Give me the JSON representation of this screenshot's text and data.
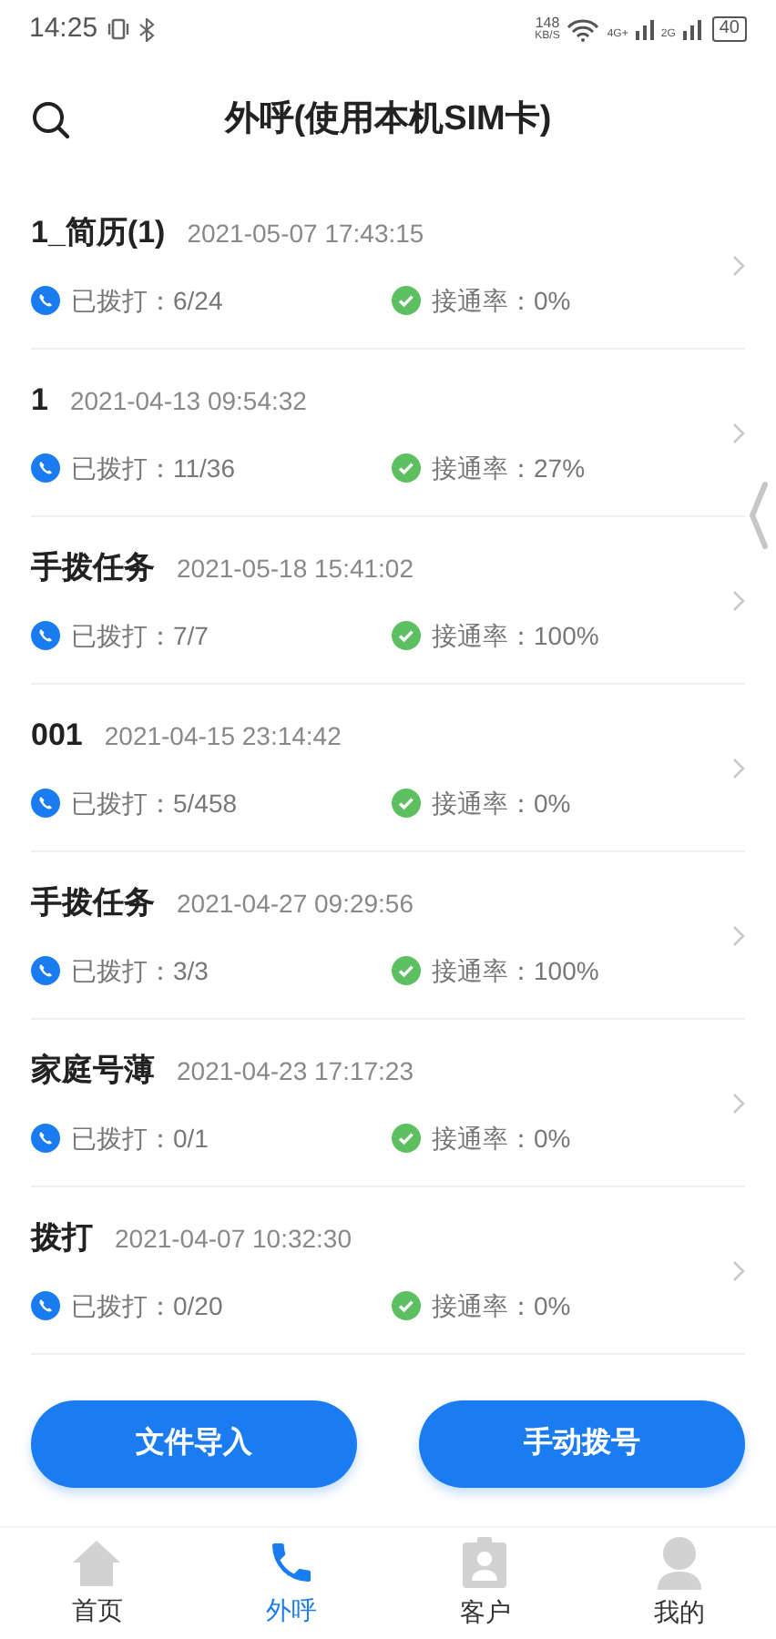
{
  "status_bar": {
    "time": "14:25",
    "speed": "148",
    "speed_unit": "KB/S",
    "network_1": "4G+",
    "network_2": "2G",
    "battery": "40"
  },
  "header": {
    "title": "外呼(使用本机SIM卡)"
  },
  "tasks": [
    {
      "name": "1_简历(1)",
      "time": "2021-05-07 17:43:15",
      "dialed": "已拨打：6/24",
      "rate": "接通率：0%"
    },
    {
      "name": "1",
      "time": "2021-04-13 09:54:32",
      "dialed": "已拨打：11/36",
      "rate": "接通率：27%"
    },
    {
      "name": "手拨任务",
      "time": "2021-05-18 15:41:02",
      "dialed": "已拨打：7/7",
      "rate": "接通率：100%"
    },
    {
      "name": "001",
      "time": "2021-04-15 23:14:42",
      "dialed": "已拨打：5/458",
      "rate": "接通率：0%"
    },
    {
      "name": "手拨任务",
      "time": "2021-04-27 09:29:56",
      "dialed": "已拨打：3/3",
      "rate": "接通率：100%"
    },
    {
      "name": "家庭号薄",
      "time": "2021-04-23 17:17:23",
      "dialed": "已拨打：0/1",
      "rate": "接通率：0%"
    },
    {
      "name": "拨打",
      "time": "2021-04-07 10:32:30",
      "dialed": "已拨打：0/20",
      "rate": "接通率：0%"
    }
  ],
  "buttons": [
    "文件导入",
    "手动拨号"
  ],
  "tabs": [
    {
      "kind": "home",
      "label": "首页",
      "selected": false
    },
    {
      "kind": "phone",
      "label": "外呼",
      "selected": true
    },
    {
      "kind": "contact",
      "label": "客户",
      "selected": false
    },
    {
      "kind": "profile",
      "label": "我的",
      "selected": false
    }
  ]
}
